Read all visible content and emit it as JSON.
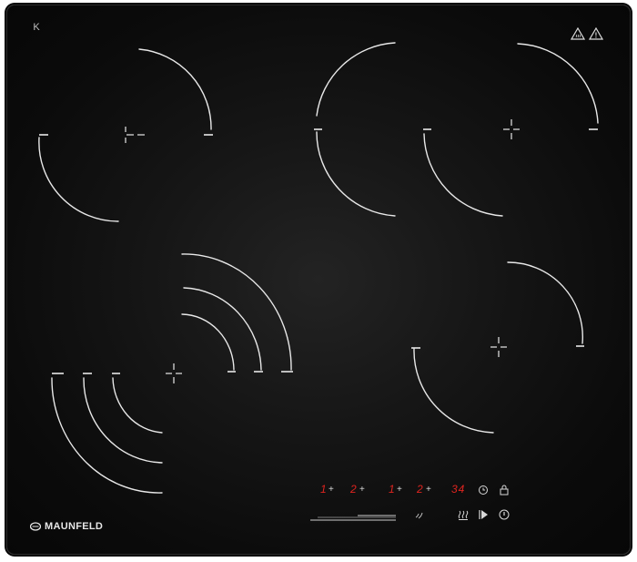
{
  "brand": {
    "name": "MAUNFELD"
  },
  "top_left_icon": {
    "name": "expand-icon",
    "glyph": "K"
  },
  "warnings": [
    {
      "name": "hot-surface-warning-icon"
    },
    {
      "name": "caution-warning-icon",
      "glyph": "!"
    }
  ],
  "control_panel": {
    "zones": [
      {
        "level": "1",
        "control_glyph": "+"
      },
      {
        "level": "2",
        "control_glyph": "+"
      },
      {
        "level": "1",
        "control_glyph": "+"
      },
      {
        "level": "2",
        "control_glyph": "+"
      }
    ],
    "timer_display": "34",
    "icons": [
      {
        "name": "timer-icon"
      },
      {
        "name": "lock-icon"
      },
      {
        "name": "heat-icon"
      },
      {
        "name": "play-icon"
      },
      {
        "name": "power-icon"
      },
      {
        "name": "bridge-icon"
      }
    ]
  },
  "colors": {
    "glass": "#0b0b0b",
    "lines": "#e8e8e8",
    "display": "#e0241f"
  }
}
